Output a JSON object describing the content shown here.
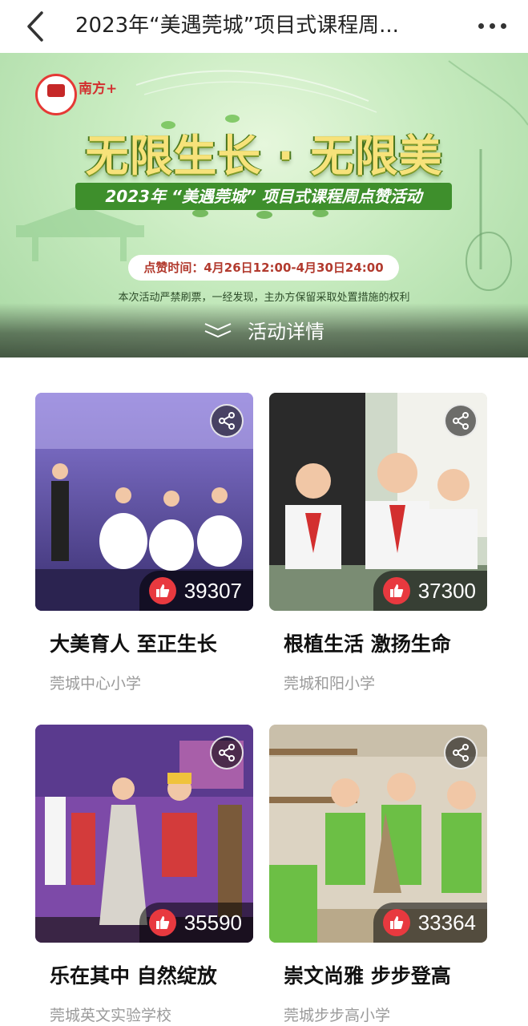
{
  "header": {
    "title": "2023年“美遇莞城”项目式课程周...",
    "back_icon": "chevron-left-icon",
    "more_icon": "more-dots-icon"
  },
  "banner": {
    "logo_text": "南方+",
    "headline": "无限生长 · 无限美",
    "subtitle": "2023年 “美遇莞城” 项目式课程周点赞活动",
    "time": "点赞时间：4月26日12:00-4月30日24:00",
    "notice": "本次活动严禁刷票，一经发现，主办方保留采取处置措施的权利",
    "details_label": "活动详情"
  },
  "entries": [
    {
      "title": "大美育人 至正生长",
      "school": "莞城中心小学",
      "likes": "39307"
    },
    {
      "title": "根植生活 激扬生命",
      "school": "莞城和阳小学",
      "likes": "37300"
    },
    {
      "title": "乐在其中 自然绽放",
      "school": "莞城英文实验学校",
      "likes": "35590"
    },
    {
      "title": "崇文尚雅 步步登高",
      "school": "莞城步步高小学",
      "likes": "33364"
    }
  ],
  "colors": {
    "like_red": "#e8393f",
    "banner_green": "#bfe6b8",
    "headline_yellow": "#f7e27a"
  }
}
